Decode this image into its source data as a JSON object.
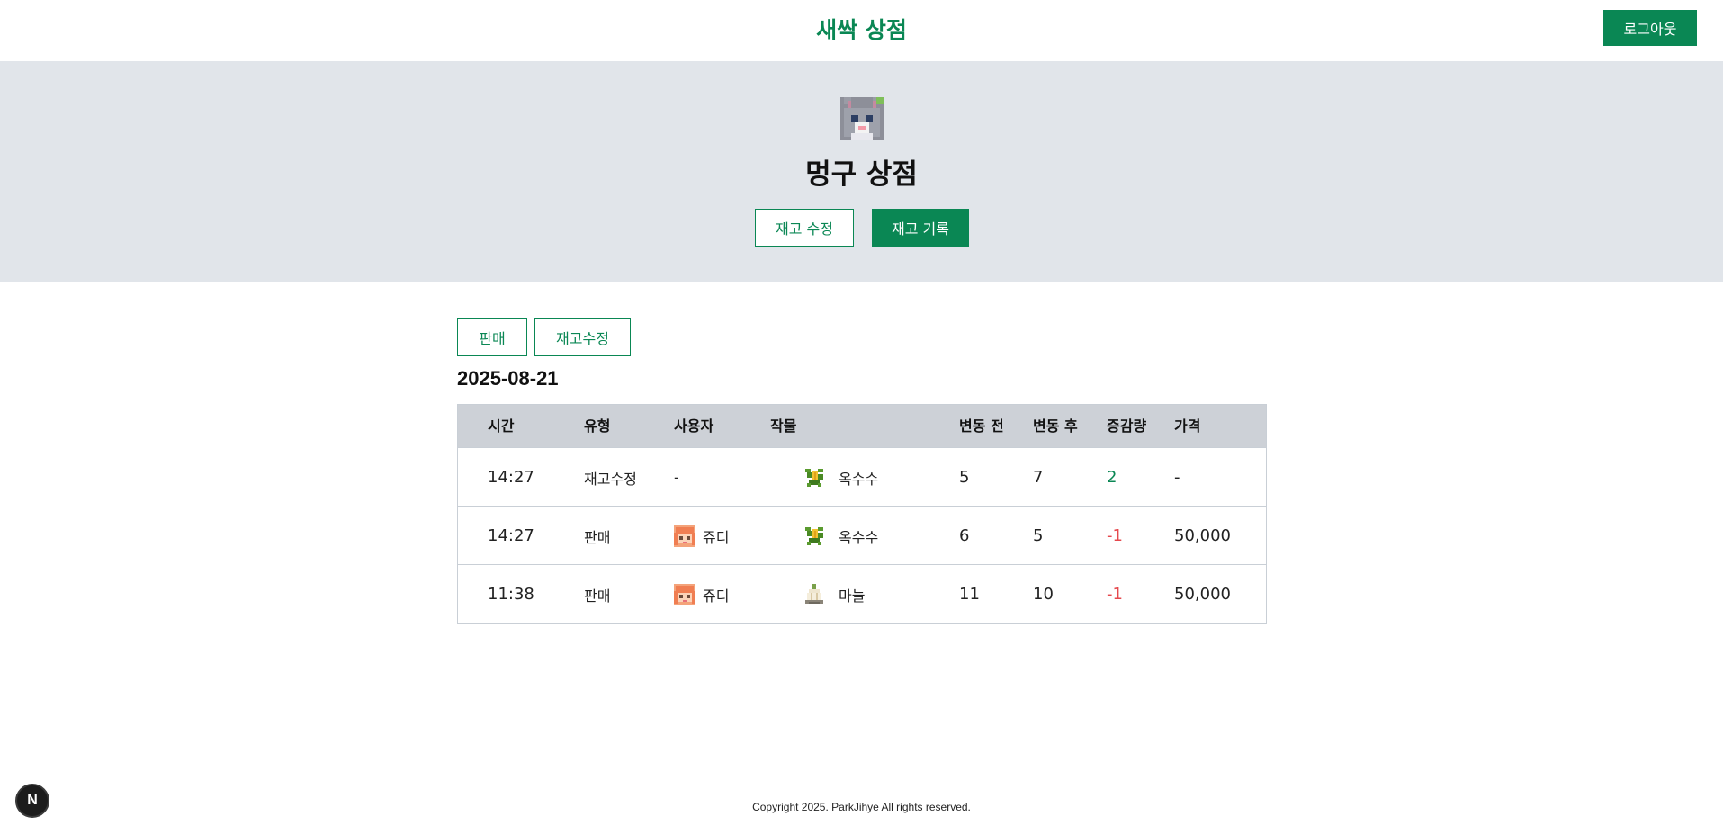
{
  "header": {
    "brand": "새싹 상점",
    "logout_label": "로그아웃"
  },
  "hero": {
    "avatar_icon": "gray-cat-pixel-avatar",
    "shop_name": "멍구 상점",
    "edit_stock_label": "재고 수정",
    "stock_history_label": "재고 기록"
  },
  "filters": {
    "sale_label": "판매",
    "stock_edit_label": "재고수정"
  },
  "date": "2025-08-21",
  "table": {
    "headers": {
      "time": "시간",
      "type": "유형",
      "user": "사용자",
      "crop": "작물",
      "before": "변동 전",
      "after": "변동 후",
      "delta": "증감량",
      "price": "가격"
    },
    "rows": [
      {
        "time": "14:27",
        "type": "재고수정",
        "user": "-",
        "user_icon": "",
        "crop": "옥수수",
        "crop_icon": "corn-icon",
        "before": "5",
        "after": "7",
        "delta": "2",
        "delta_sign": "positive",
        "price": "-"
      },
      {
        "time": "14:27",
        "type": "판매",
        "user": "쥬디",
        "user_icon": "orange-hair-avatar",
        "crop": "옥수수",
        "crop_icon": "corn-icon",
        "before": "6",
        "after": "5",
        "delta": "-1",
        "delta_sign": "negative",
        "price": "50,000"
      },
      {
        "time": "11:38",
        "type": "판매",
        "user": "쥬디",
        "user_icon": "orange-hair-avatar",
        "crop": "마늘",
        "crop_icon": "garlic-icon",
        "before": "11",
        "after": "10",
        "delta": "-1",
        "delta_sign": "negative",
        "price": "50,000"
      }
    ]
  },
  "footer": {
    "copyright": "Copyright 2025. ParkJihye All rights reserved."
  },
  "dev_badge": {
    "label": "N"
  },
  "colors": {
    "brand_green": "#0a8754",
    "hero_bg": "#e1e5ea",
    "table_header_bg": "#cdd1d7",
    "negative_red": "#e5484d"
  }
}
